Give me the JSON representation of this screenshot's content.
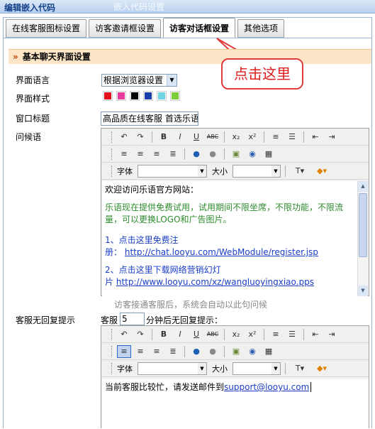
{
  "header": {
    "title": "编辑嵌入代码",
    "ghost_title": "嵌入代码设置"
  },
  "tabs": [
    {
      "label": "在线客服图标设置"
    },
    {
      "label": "访客邀请框设置"
    },
    {
      "label": "访客对话框设置"
    },
    {
      "label": "其他选项"
    }
  ],
  "section": {
    "arrow": "»",
    "title": "基本聊天界面设置"
  },
  "callout": {
    "text": "点击这里"
  },
  "form": {
    "language_label": "界面语言",
    "language_value": "根据浏览器设置",
    "style_label": "界面样式",
    "style_colors": [
      "#e8101d",
      "#e83c9c",
      "#000000",
      "#1d3fae",
      "#6fd4e4",
      "#7ecd3b"
    ],
    "window_title_label": "窗口标题",
    "window_title_value": "高品质在线客服 首选乐语",
    "greeting_label": "问候语",
    "no_reply_label": "客服无回复提示"
  },
  "editor": {
    "font_label": "字体",
    "size_label": "大小",
    "greeting": {
      "line1": "欢迎访问乐语官方网站：",
      "line2": "乐语现在提供免费试用，试用期间不限坐席，不限功能，不限流量，可以更换LOGO和广告图片。",
      "line3a": "1、点击这里免费注",
      "line3b": "册：",
      "line3link": "http://chat.looyu.com/WebModule/register.jsp",
      "line4": "2、点击这里下载网络营销幻灯",
      "line4b": "片",
      "line4link": "http://www.looyu.com/xz/wangluoyingxiao.pps"
    },
    "hint": "访客接通客服后，系统会自动以此句问候",
    "reply": {
      "prefix": "客服",
      "minutes": "5",
      "suffix": "分钟后无回复提示：",
      "text": "当前客服比较忙，请发送邮件到",
      "email": "support@looyu.com"
    }
  }
}
